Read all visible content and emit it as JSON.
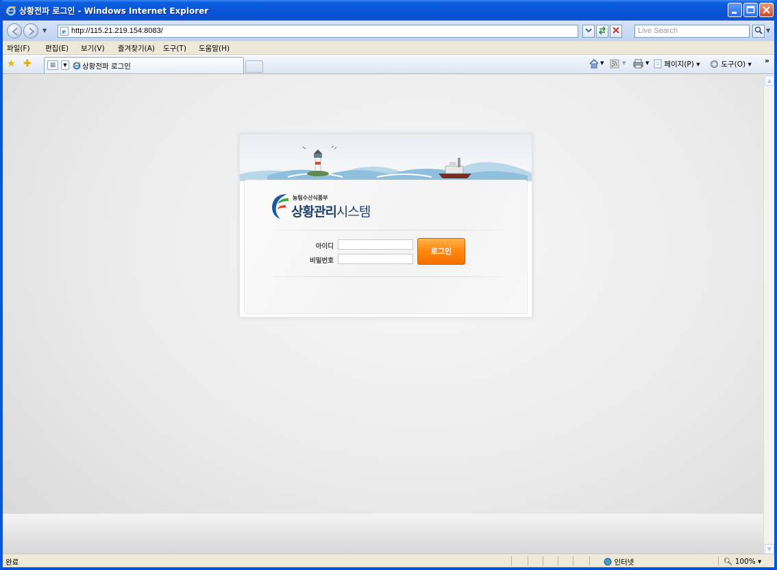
{
  "window": {
    "title": "상황전파 로그인 - Windows Internet Explorer"
  },
  "address_bar": {
    "url": "http://115.21.219.154:8083/",
    "search_placeholder": "Live Search"
  },
  "menu": {
    "items": [
      "파일(F)",
      "편집(E)",
      "보기(V)",
      "즐겨찾기(A)",
      "도구(T)",
      "도움말(H)"
    ]
  },
  "tabs": {
    "active_label": "상황전파 로그인"
  },
  "command_bar": {
    "page_label": "페이지(P)",
    "tools_label": "도구(O)"
  },
  "login": {
    "ministry": "농림수산식품부",
    "system_name_part1": "상황관리",
    "system_name_part2": "시스템",
    "id_label": "아이디",
    "password_label": "비밀번호",
    "id_value": "",
    "password_value": "",
    "login_button": "로그인"
  },
  "status_bar": {
    "status_text": "완료",
    "zone": "인터넷",
    "zoom": "100%"
  },
  "colors": {
    "titlebar": "#0a55d8",
    "login_button": "#ff8a12",
    "system_name": "#1e3f6b",
    "logo_green": "#2e8a3c"
  }
}
